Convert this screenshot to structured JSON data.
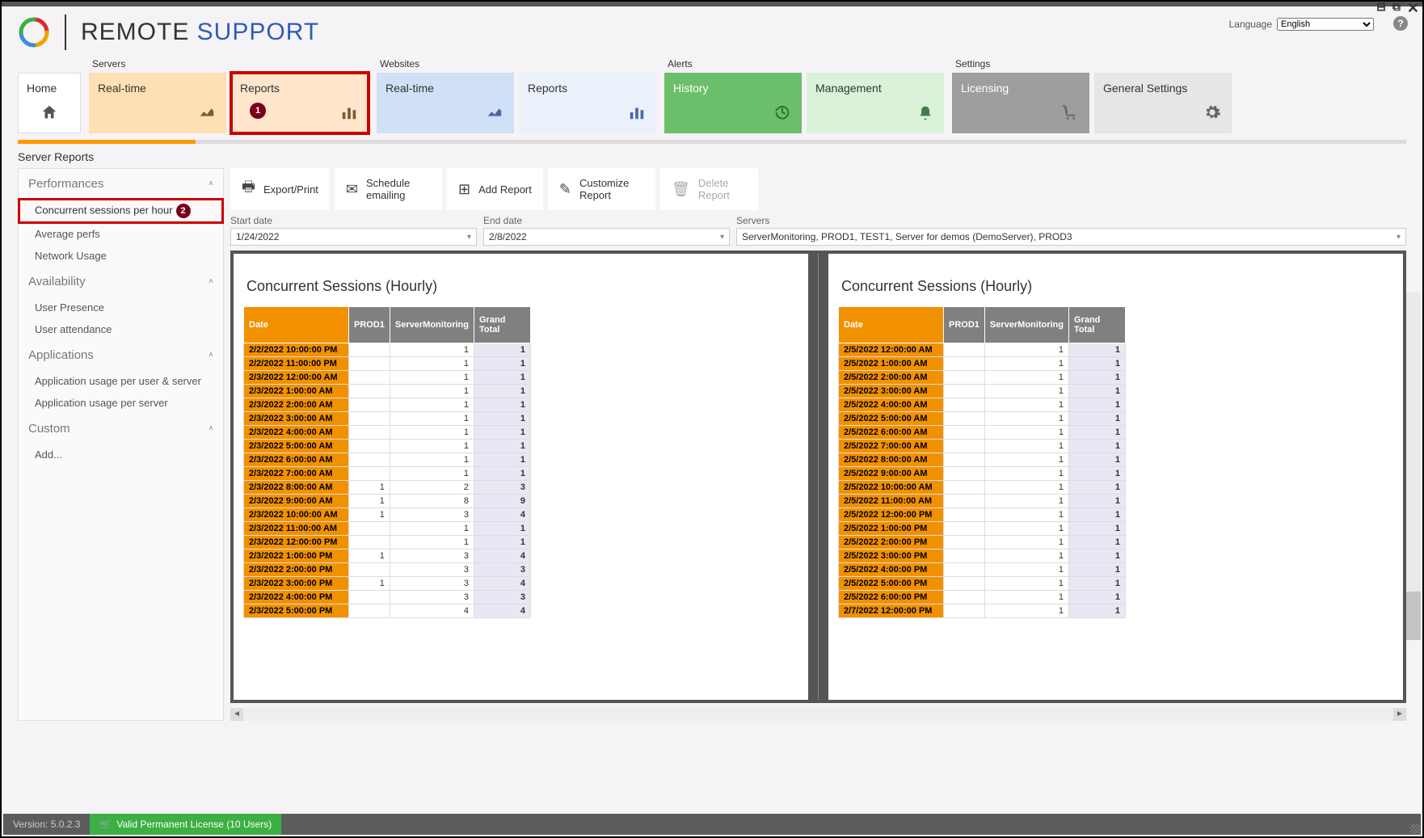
{
  "brand": {
    "name_a": "REMOTE ",
    "name_b": "SUPPORT"
  },
  "language": {
    "label": "Language",
    "selected": "English"
  },
  "nav": {
    "home": "Home",
    "groups": {
      "servers": {
        "label": "Servers",
        "realtime": "Real-time",
        "reports": "Reports"
      },
      "websites": {
        "label": "Websites",
        "realtime": "Real-time",
        "reports": "Reports"
      },
      "alerts": {
        "label": "Alerts",
        "history": "History",
        "management": "Management"
      },
      "settings": {
        "label": "Settings",
        "licensing": "Licensing",
        "general": "General Settings"
      }
    },
    "badge1": "1"
  },
  "section_title": "Server Reports",
  "sidebar": {
    "performances": {
      "header": "Performances",
      "concurrent": "Concurrent sessions per hour",
      "avg": "Average perfs",
      "network": "Network Usage"
    },
    "availability": {
      "header": "Availability",
      "presence": "User Presence",
      "attendance": "User attendance"
    },
    "applications": {
      "header": "Applications",
      "peruser": "Application usage per user & server",
      "perserver": "Application usage per server"
    },
    "custom": {
      "header": "Custom",
      "add": "Add..."
    },
    "badge2": "2"
  },
  "toolbar": {
    "export": "Export/Print",
    "schedule": "Schedule emailing",
    "add": "Add Report",
    "customize": "Customize Report",
    "delete": "Delete Report"
  },
  "filters": {
    "start_label": "Start date",
    "start_value": "1/24/2022",
    "end_label": "End date",
    "end_value": "2/8/2022",
    "servers_label": "Servers",
    "servers_value": "ServerMonitoring, PROD1, TEST1, Server for demos (DemoServer), PROD3"
  },
  "report": {
    "title": "Concurrent Sessions (Hourly)",
    "columns": {
      "date": "Date",
      "prod1": "PROD1",
      "sm": "ServerMonitoring",
      "gt": "Grand Total"
    }
  },
  "chart_data": [
    {
      "type": "table",
      "title": "Concurrent Sessions (Hourly)",
      "columns": [
        "Date",
        "PROD1",
        "ServerMonitoring",
        "Grand Total"
      ],
      "rows": [
        [
          "2/2/2022 10:00:00 PM",
          null,
          1,
          1
        ],
        [
          "2/2/2022 11:00:00 PM",
          null,
          1,
          1
        ],
        [
          "2/3/2022 12:00:00 AM",
          null,
          1,
          1
        ],
        [
          "2/3/2022 1:00:00 AM",
          null,
          1,
          1
        ],
        [
          "2/3/2022 2:00:00 AM",
          null,
          1,
          1
        ],
        [
          "2/3/2022 3:00:00 AM",
          null,
          1,
          1
        ],
        [
          "2/3/2022 4:00:00 AM",
          null,
          1,
          1
        ],
        [
          "2/3/2022 5:00:00 AM",
          null,
          1,
          1
        ],
        [
          "2/3/2022 6:00:00 AM",
          null,
          1,
          1
        ],
        [
          "2/3/2022 7:00:00 AM",
          null,
          1,
          1
        ],
        [
          "2/3/2022 8:00:00 AM",
          1,
          2,
          3
        ],
        [
          "2/3/2022 9:00:00 AM",
          1,
          8,
          9
        ],
        [
          "2/3/2022 10:00:00 AM",
          1,
          3,
          4
        ],
        [
          "2/3/2022 11:00:00 AM",
          null,
          1,
          1
        ],
        [
          "2/3/2022 12:00:00 PM",
          null,
          1,
          1
        ],
        [
          "2/3/2022 1:00:00 PM",
          1,
          3,
          4
        ],
        [
          "2/3/2022 2:00:00 PM",
          null,
          3,
          3
        ],
        [
          "2/3/2022 3:00:00 PM",
          1,
          3,
          4
        ],
        [
          "2/3/2022 4:00:00 PM",
          null,
          3,
          3
        ],
        [
          "2/3/2022 5:00:00 PM",
          null,
          4,
          4
        ]
      ]
    },
    {
      "type": "table",
      "title": "Concurrent Sessions (Hourly)",
      "columns": [
        "Date",
        "PROD1",
        "ServerMonitoring",
        "Grand Total"
      ],
      "rows": [
        [
          "2/5/2022 12:00:00 AM",
          null,
          1,
          1
        ],
        [
          "2/5/2022 1:00:00 AM",
          null,
          1,
          1
        ],
        [
          "2/5/2022 2:00:00 AM",
          null,
          1,
          1
        ],
        [
          "2/5/2022 3:00:00 AM",
          null,
          1,
          1
        ],
        [
          "2/5/2022 4:00:00 AM",
          null,
          1,
          1
        ],
        [
          "2/5/2022 5:00:00 AM",
          null,
          1,
          1
        ],
        [
          "2/5/2022 6:00:00 AM",
          null,
          1,
          1
        ],
        [
          "2/5/2022 7:00:00 AM",
          null,
          1,
          1
        ],
        [
          "2/5/2022 8:00:00 AM",
          null,
          1,
          1
        ],
        [
          "2/5/2022 9:00:00 AM",
          null,
          1,
          1
        ],
        [
          "2/5/2022 10:00:00 AM",
          null,
          1,
          1
        ],
        [
          "2/5/2022 11:00:00 AM",
          null,
          1,
          1
        ],
        [
          "2/5/2022 12:00:00 PM",
          null,
          1,
          1
        ],
        [
          "2/5/2022 1:00:00 PM",
          null,
          1,
          1
        ],
        [
          "2/5/2022 2:00:00 PM",
          null,
          1,
          1
        ],
        [
          "2/5/2022 3:00:00 PM",
          null,
          1,
          1
        ],
        [
          "2/5/2022 4:00:00 PM",
          null,
          1,
          1
        ],
        [
          "2/5/2022 5:00:00 PM",
          null,
          1,
          1
        ],
        [
          "2/5/2022 6:00:00 PM",
          null,
          1,
          1
        ],
        [
          "2/7/2022 12:00:00 PM",
          null,
          1,
          1
        ]
      ]
    }
  ],
  "status": {
    "version": "Version: 5.0.2.3",
    "license": "Valid Permanent License (10 Users)"
  }
}
